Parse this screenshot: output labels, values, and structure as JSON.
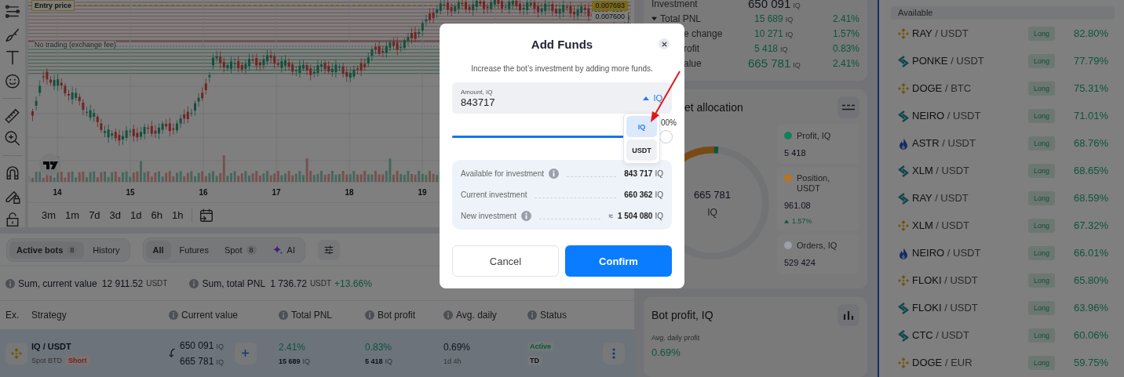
{
  "chart": {
    "entry_label": "Entry price",
    "no_trading_label": "No trading (exchange fee)",
    "price_labels": [
      {
        "text": "0.007693",
        "kind": "current"
      },
      {
        "text": "0.007600",
        "kind": "plain"
      }
    ],
    "dates": [
      "14",
      "15",
      "16",
      "17",
      "18",
      "19"
    ],
    "timeframes": [
      "3m",
      "1m",
      "7d",
      "3d",
      "1d",
      "6h",
      "1h"
    ]
  },
  "bot_tabs": [
    {
      "label": "Active bots",
      "count": "8",
      "selected": true
    },
    {
      "label": "History",
      "selected": false
    }
  ],
  "filters": [
    {
      "label": "All",
      "selected": true
    },
    {
      "label": "Futures",
      "selected": false
    },
    {
      "label": "Spot",
      "count": "8",
      "selected": false
    },
    {
      "label": "AI",
      "kind": "ai",
      "selected": false
    }
  ],
  "summary": [
    {
      "label": "Sum, current value",
      "value": "12 911.52",
      "unit": "USDT"
    },
    {
      "label": "Sum, total PNL",
      "value": "1 736.72",
      "unit": "USDT",
      "change": "+13.66%"
    }
  ],
  "table": {
    "columns": [
      {
        "label": "Ex.",
        "info": false
      },
      {
        "label": "Strategy",
        "info": false
      },
      {
        "label": "Current value",
        "info": true
      },
      {
        "label": "Total PNL",
        "info": true
      },
      {
        "label": "Bot profit",
        "info": true
      },
      {
        "label": "Avg. daily",
        "info": true
      },
      {
        "label": "Status",
        "info": true
      }
    ],
    "rows": [
      {
        "kind": "binance",
        "pair": "IQ / USDT",
        "type": "Spot BTD",
        "side": "Short",
        "value_1": "650 091",
        "unit_1": "IQ",
        "value_2": "665 781",
        "unit_2": "IQ",
        "pnl_pct": "2.41%",
        "pnl": "15 689",
        "pnl_unit": "IQ",
        "profit_pct": "0.83%",
        "profit": "5 418",
        "profit_unit": "IQ",
        "avg": "0.69%",
        "duration": "1d 4h",
        "status": "Active",
        "tag": "TD",
        "selected": true
      }
    ]
  },
  "stats": [
    {
      "label": "Investment",
      "value": "650 091",
      "unit": "IQ",
      "kind": "main"
    },
    {
      "label": "Total PNL",
      "value": "15 689",
      "unit": "IQ",
      "pct": "2.41%",
      "kind": "sub",
      "expanded": true
    },
    {
      "label": "e change",
      "value": "10 271",
      "unit": "IQ",
      "pct": "1.57%",
      "kind": "sub"
    },
    {
      "label": "rofit",
      "value": "5 418",
      "unit": "IQ",
      "pct": "0.83%",
      "kind": "sub"
    },
    {
      "label": "alue",
      "value": "665 781",
      "unit": "IQ",
      "pct": "2.41%",
      "kind": "total"
    }
  ],
  "allocation": {
    "title": "et allocation",
    "total": "665 781",
    "unit": "IQ",
    "legend": [
      {
        "label": "Profit, IQ",
        "value": "5 418",
        "color": "#13805a"
      },
      {
        "label": "Position, USDT",
        "value": "961.08",
        "change": "1.57%",
        "color": "#b8741f"
      },
      {
        "label": "Orders, IQ",
        "value": "529 424",
        "color": "#9b9fa8"
      }
    ]
  },
  "bot_profit": {
    "title": "Bot profit, IQ",
    "avg_label": "Avg. daily profit",
    "avg_value": "0.69%"
  },
  "markets": {
    "header": "Available",
    "rows": [
      {
        "kind": "binance",
        "base": "RAY",
        "quote": "/ USDT",
        "side": "Long",
        "pct": "82.80%"
      },
      {
        "kind": "arrows",
        "base": "PONKE",
        "quote": "/ USDT",
        "side": "Long",
        "pct": "77.79%"
      },
      {
        "kind": "binance",
        "base": "DOGE",
        "quote": "/ BTC",
        "side": "Long",
        "pct": "75.31%"
      },
      {
        "kind": "arrows",
        "base": "NEIRO",
        "quote": "/ USDT",
        "side": "Long",
        "pct": "71.01%"
      },
      {
        "kind": "flame",
        "base": "ASTR",
        "quote": "/ USDT",
        "side": "Long",
        "pct": "68.76%"
      },
      {
        "kind": "arrows",
        "base": "XLM",
        "quote": "/ USDT",
        "side": "Long",
        "pct": "68.65%"
      },
      {
        "kind": "arrows",
        "base": "RAY",
        "quote": "/ USDT",
        "side": "Long",
        "pct": "68.59%"
      },
      {
        "kind": "binance",
        "base": "XLM",
        "quote": "/ USDT",
        "side": "Long",
        "pct": "67.32%"
      },
      {
        "kind": "flame",
        "base": "NEIRO",
        "quote": "/ USDT",
        "side": "Long",
        "pct": "66.01%"
      },
      {
        "kind": "binance",
        "base": "FLOKI",
        "quote": "/ USDT",
        "side": "Long",
        "pct": "65.80%"
      },
      {
        "kind": "arrows",
        "base": "FLOKI",
        "quote": "/ USDT",
        "side": "Long",
        "pct": "63.96%"
      },
      {
        "kind": "arrows",
        "base": "CTC",
        "quote": "/ USDT",
        "side": "Long",
        "pct": "60.06%"
      },
      {
        "kind": "binance",
        "base": "DOGE",
        "quote": "/ EUR",
        "side": "Long",
        "pct": "59.75%"
      }
    ]
  },
  "modal": {
    "title": "Add Funds",
    "subtitle": "Increase the bot’s investment by adding more funds.",
    "amount": {
      "label": "Amount, IQ",
      "value": "843717",
      "currency": "IQ",
      "expanded": true
    },
    "currency_options": [
      {
        "label": "IQ",
        "selected": true
      },
      {
        "label": "USDT",
        "selected": false
      }
    ],
    "slider": {
      "level": 1,
      "reading": "00%"
    },
    "details": [
      {
        "label": "Available for investment",
        "info": true,
        "value": "843 717",
        "unit": "IQ"
      },
      {
        "label": "Current investment",
        "info": false,
        "value": "660 362",
        "unit": "IQ"
      },
      {
        "label": "New investment",
        "info": true,
        "approx": "≈",
        "value": "1 504 080",
        "unit": "IQ"
      }
    ],
    "buttons": [
      {
        "label": "Cancel",
        "kind": "secondary"
      },
      {
        "label": "Confirm",
        "kind": "primary"
      }
    ]
  }
}
